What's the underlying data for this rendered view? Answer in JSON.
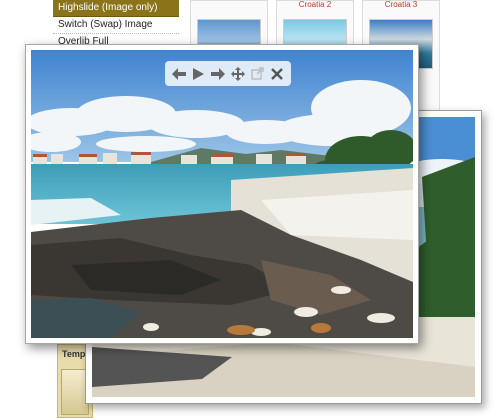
{
  "menu": {
    "items": [
      {
        "label": "Highslide (Image only)",
        "active": true
      },
      {
        "label": "Switch (Swap) Image",
        "active": false
      },
      {
        "label": "Overlib Full",
        "active": false
      }
    ]
  },
  "grid": {
    "captions": [
      "Croatia 2",
      "Croatia 3"
    ]
  },
  "sidebar_template": {
    "title": "Temp"
  },
  "controls": {
    "previous": "previous-icon",
    "play": "play-icon",
    "next": "next-icon",
    "move": "move-icon",
    "full_expand": "full-expand-icon",
    "close": "close-icon"
  },
  "colors": {
    "menu_active_bg": "#8a7318",
    "caption_red": "#c0392b",
    "sky": "#4a8fd4"
  }
}
